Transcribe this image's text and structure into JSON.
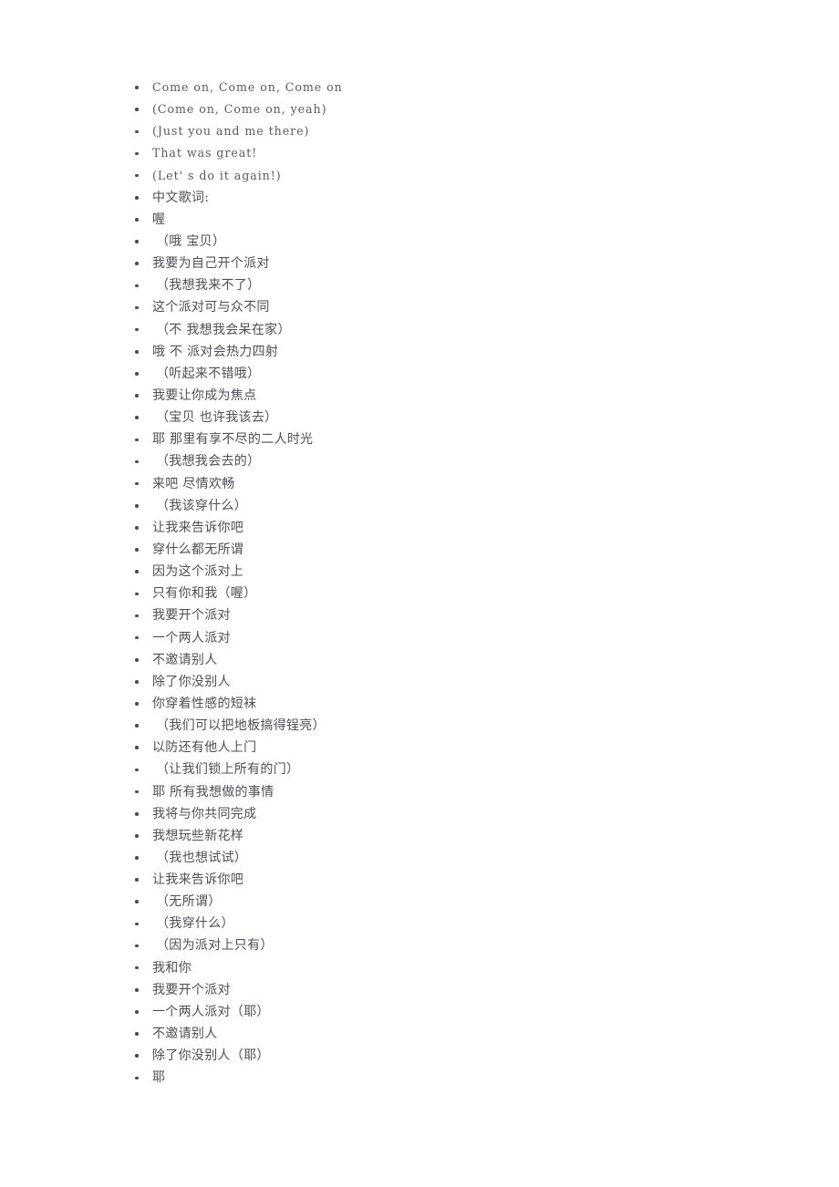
{
  "document": {
    "page_background": "#ffffff",
    "text_color": "#54545a",
    "bullet_color": "#4a4a50",
    "section_header": "中文歌词:"
  },
  "lyrics": {
    "lines": [
      {
        "text": "Come on, Come on, Come on",
        "lang": "en",
        "indent": false
      },
      {
        "text": "(Come on, Come on, yeah)",
        "lang": "en",
        "indent": false
      },
      {
        "text": "(Just you and me there)",
        "lang": "en",
        "indent": false
      },
      {
        "text": "That was great!",
        "lang": "en",
        "indent": false
      },
      {
        "text": "(Let' s do it again!)",
        "lang": "en",
        "indent": false
      },
      {
        "text": "中文歌词:",
        "lang": "zh",
        "indent": false
      },
      {
        "text": "喔",
        "lang": "zh",
        "indent": false
      },
      {
        "text": "（哦 宝贝）",
        "lang": "zh",
        "indent": true
      },
      {
        "text": "我要为自己开个派对",
        "lang": "zh",
        "indent": false
      },
      {
        "text": "（我想我来不了）",
        "lang": "zh",
        "indent": true
      },
      {
        "text": "这个派对可与众不同",
        "lang": "zh",
        "indent": false
      },
      {
        "text": "（不 我想我会呆在家）",
        "lang": "zh",
        "indent": true
      },
      {
        "text": "哦 不 派对会热力四射",
        "lang": "zh",
        "indent": false
      },
      {
        "text": "（听起来不错哦）",
        "lang": "zh",
        "indent": true
      },
      {
        "text": "我要让你成为焦点",
        "lang": "zh",
        "indent": false
      },
      {
        "text": "（宝贝 也许我该去）",
        "lang": "zh",
        "indent": true
      },
      {
        "text": "耶 那里有享不尽的二人时光",
        "lang": "zh",
        "indent": false
      },
      {
        "text": "（我想我会去的）",
        "lang": "zh",
        "indent": true
      },
      {
        "text": "来吧 尽情欢畅",
        "lang": "zh",
        "indent": false
      },
      {
        "text": "（我该穿什么）",
        "lang": "zh",
        "indent": true
      },
      {
        "text": "让我来告诉你吧",
        "lang": "zh",
        "indent": false
      },
      {
        "text": "穿什么都无所谓",
        "lang": "zh",
        "indent": false
      },
      {
        "text": "因为这个派对上",
        "lang": "zh",
        "indent": false
      },
      {
        "text": "只有你和我（喔）",
        "lang": "zh",
        "indent": false
      },
      {
        "text": "我要开个派对",
        "lang": "zh",
        "indent": false
      },
      {
        "text": "一个两人派对",
        "lang": "zh",
        "indent": false
      },
      {
        "text": "不邀请别人",
        "lang": "zh",
        "indent": false
      },
      {
        "text": "除了你没别人",
        "lang": "zh",
        "indent": false
      },
      {
        "text": "你穿着性感的短袜",
        "lang": "zh",
        "indent": false
      },
      {
        "text": "（我们可以把地板搞得锃亮）",
        "lang": "zh",
        "indent": true
      },
      {
        "text": "以防还有他人上门",
        "lang": "zh",
        "indent": false
      },
      {
        "text": "（让我们锁上所有的门）",
        "lang": "zh",
        "indent": true
      },
      {
        "text": "耶 所有我想做的事情",
        "lang": "zh",
        "indent": false
      },
      {
        "text": "我将与你共同完成",
        "lang": "zh",
        "indent": false
      },
      {
        "text": "我想玩些新花样",
        "lang": "zh",
        "indent": false
      },
      {
        "text": "（我也想试试）",
        "lang": "zh",
        "indent": true
      },
      {
        "text": "让我来告诉你吧",
        "lang": "zh",
        "indent": false
      },
      {
        "text": "（无所谓）",
        "lang": "zh",
        "indent": true
      },
      {
        "text": "（我穿什么）",
        "lang": "zh",
        "indent": true
      },
      {
        "text": "（因为派对上只有）",
        "lang": "zh",
        "indent": true
      },
      {
        "text": "我和你",
        "lang": "zh",
        "indent": false
      },
      {
        "text": "我要开个派对",
        "lang": "zh",
        "indent": false
      },
      {
        "text": "一个两人派对（耶）",
        "lang": "zh",
        "indent": false
      },
      {
        "text": "不邀请别人",
        "lang": "zh",
        "indent": false
      },
      {
        "text": "除了你没别人（耶）",
        "lang": "zh",
        "indent": false
      },
      {
        "text": "耶",
        "lang": "zh",
        "indent": false
      }
    ]
  }
}
